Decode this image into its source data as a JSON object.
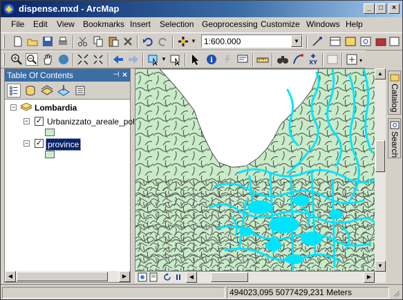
{
  "window": {
    "title": "dispense.mxd - ArcMap",
    "controls": [
      "_",
      "□",
      "×"
    ]
  },
  "menu": [
    "File",
    "Edit",
    "View",
    "Bookmarks",
    "Insert",
    "Selection",
    "Geoprocessing",
    "Customize",
    "Windows",
    "Help"
  ],
  "toolbar": {
    "scale": "1:600.000"
  },
  "toc": {
    "title": "Table Of Contents",
    "pin": "⊣",
    "close": "×",
    "root_layer": "Lombardia",
    "layers": [
      {
        "name": "Urbanizzato_areale_poly",
        "checked": true,
        "selected": false
      },
      {
        "name": "province",
        "checked": true,
        "selected": true
      }
    ]
  },
  "side_tabs": [
    "Catalog",
    "Search"
  ],
  "status": {
    "coordinates": "494023,095  5077429,231 Meters"
  },
  "colors": {
    "map_land": "#c8ebc8",
    "urban_polygons": "#00e5ff",
    "boundary_lines": "#505050",
    "selection": "#0a246a"
  }
}
